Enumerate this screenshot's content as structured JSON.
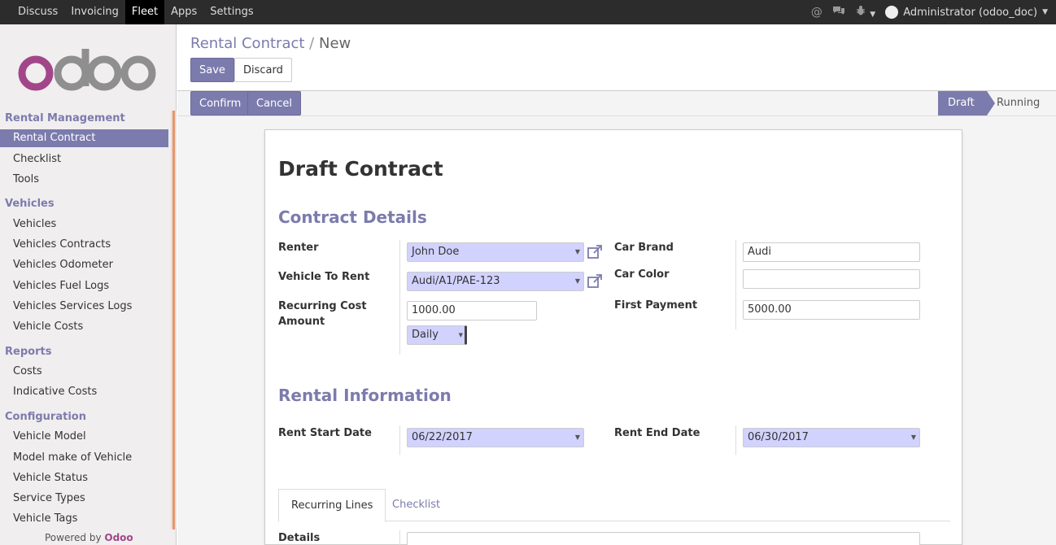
{
  "topbar": {
    "menu": [
      "Discuss",
      "Invoicing",
      "Fleet",
      "Apps",
      "Settings"
    ],
    "active_menu": "Fleet",
    "user": "Administrator (odoo_doc)"
  },
  "sidebar": {
    "sections": [
      {
        "title": "Rental Management",
        "items": [
          "Rental Contract",
          "Checklist",
          "Tools"
        ]
      },
      {
        "title": "Vehicles",
        "items": [
          "Vehicles",
          "Vehicles Contracts",
          "Vehicles Odometer",
          "Vehicles Fuel Logs",
          "Vehicles Services Logs",
          "Vehicle Costs"
        ]
      },
      {
        "title": "Reports",
        "items": [
          "Costs",
          "Indicative Costs"
        ]
      },
      {
        "title": "Configuration",
        "items": [
          "Vehicle Model",
          "Model make of Vehicle",
          "Vehicle Status",
          "Service Types",
          "Vehicle Tags"
        ]
      }
    ],
    "active_item": "Rental Contract",
    "powered_prefix": "Powered by",
    "powered_brand": "Odoo"
  },
  "breadcrumb": {
    "parent": "Rental Contract",
    "sep": "/",
    "current": "New"
  },
  "buttons": {
    "save": "Save",
    "discard": "Discard",
    "confirm": "Confirm",
    "cancel": "Cancel"
  },
  "statusbar": {
    "stages": [
      "Draft",
      "Running"
    ],
    "active": "Draft"
  },
  "form": {
    "title": "Draft Contract",
    "contract_details_title": "Contract Details",
    "renter": {
      "label": "Renter",
      "value": "John Doe"
    },
    "vehicle": {
      "label": "Vehicle To Rent",
      "value": "Audi/A1/PAE-123"
    },
    "recurring_cost": {
      "label_line1": "Recurring Cost",
      "label_line2": "Amount",
      "value": "1000.00",
      "period": "Daily"
    },
    "car_brand": {
      "label": "Car Brand",
      "value": "Audi"
    },
    "car_color": {
      "label": "Car Color",
      "value": ""
    },
    "first_payment": {
      "label": "First Payment",
      "value": "5000.00"
    },
    "rental_info_title": "Rental Information",
    "start_date": {
      "label": "Rent Start Date",
      "value": "06/22/2017"
    },
    "end_date": {
      "label": "Rent End Date",
      "value": "06/30/2017"
    },
    "tabs": [
      "Recurring Lines",
      "Checklist"
    ],
    "details_label": "Details"
  }
}
